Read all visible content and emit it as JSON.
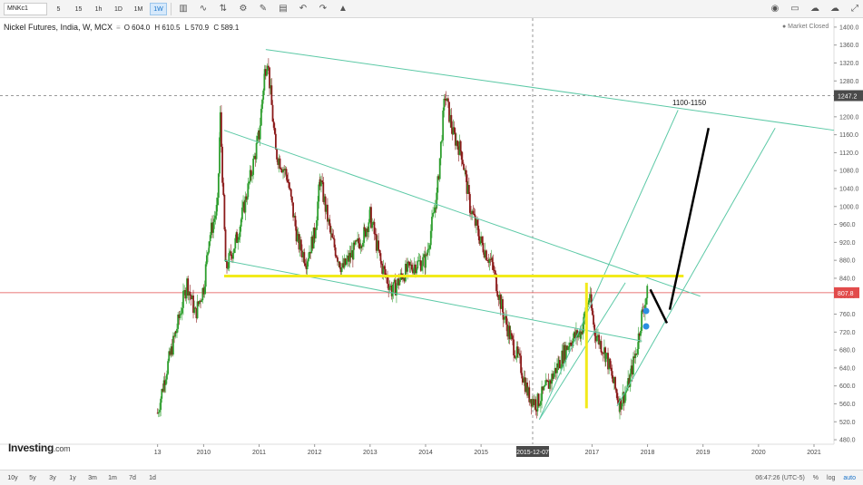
{
  "toolbar": {
    "symbol": "MNKc1",
    "intervals": [
      {
        "label": "5",
        "active": false
      },
      {
        "label": "15",
        "active": false
      },
      {
        "label": "1h",
        "active": false
      },
      {
        "label": "1D",
        "active": false
      },
      {
        "label": "1M",
        "active": false
      },
      {
        "label": "1W",
        "active": true
      }
    ],
    "tools": [
      "candle-type-icon",
      "indicator-icon",
      "compare-icon",
      "settings-icon",
      "drawing-icon",
      "template-icon",
      "undo-icon",
      "redo-icon",
      "alert-icon"
    ],
    "right_tools": [
      "camera-icon",
      "layout-icon",
      "cloud-icon",
      "cloud-save-icon",
      "fullscreen-icon"
    ]
  },
  "legend": {
    "title": "Nickel Futures, India, W, MCX",
    "open": "O 604.0",
    "high": "H 610.5",
    "low": "L 570.9",
    "close": "C 589.1"
  },
  "market_status": "● Market Closed",
  "annotation_target": "1100-1150",
  "logo_text": "Investing",
  "logo_suffix": ".com",
  "time_ranges": [
    "10y",
    "5y",
    "3y",
    "1y",
    "3m",
    "1m",
    "7d",
    "1d"
  ],
  "status_bar": {
    "clock": "06:47:26 (UTC-5)",
    "percent": "%",
    "log": "log",
    "auto": "auto"
  },
  "price_badges": {
    "crosshair": "1247.2",
    "last": "807.8"
  },
  "crosshair_date": "2015-12-07",
  "colors": {
    "up": "#2e9e2e",
    "down": "#8b1a1a",
    "trendline": "#5cc9a6",
    "horizontal": "#f2ea1a",
    "price_line": "#e24b4b",
    "target_arrow": "#000000"
  },
  "chart_data": {
    "type": "candlestick",
    "y_ticks": [
      1400,
      1360,
      1320,
      1280,
      1240,
      1200,
      1160,
      1120,
      1080,
      1040,
      1000,
      960,
      920,
      880,
      840,
      800,
      760,
      720,
      680,
      640,
      600,
      560,
      520,
      480
    ],
    "y_tick_labels": [
      "1400.0",
      "1360.0",
      "1320.0",
      "1280.0",
      "1240.0",
      "1200.0",
      "1160.0",
      "1120.0",
      "1080.0",
      "1040.0",
      "1000.0",
      "960.0",
      "920.0",
      "880.0",
      "840.0",
      "800.0",
      "760.0",
      "720.0",
      "680.0",
      "640.0",
      "600.0",
      "560.0",
      "520.0",
      "480.0"
    ],
    "x_ticks": [
      {
        "label": "13",
        "t": 2009.17
      },
      {
        "label": "2010",
        "t": 2010.0
      },
      {
        "label": "2011",
        "t": 2011.0
      },
      {
        "label": "2012",
        "t": 2012.0
      },
      {
        "label": "2013",
        "t": 2013.0
      },
      {
        "label": "2014",
        "t": 2014.0
      },
      {
        "label": "2015",
        "t": 2015.0
      },
      {
        "label": "2017",
        "t": 2017.0
      },
      {
        "label": "2018",
        "t": 2018.0
      },
      {
        "label": "2019",
        "t": 2019.0
      },
      {
        "label": "2020",
        "t": 2020.0
      },
      {
        "label": "2021",
        "t": 2021.0
      }
    ],
    "y_range": [
      470,
      1420
    ],
    "x_range": [
      2006.33,
      2021.36
    ],
    "crosshair": {
      "t": 2015.93,
      "price": 1247.2
    },
    "last_price": 807.8,
    "price_path": [
      [
        2009.17,
        540
      ],
      [
        2009.3,
        620
      ],
      [
        2009.5,
        720
      ],
      [
        2009.7,
        830
      ],
      [
        2009.85,
        760
      ],
      [
        2010.0,
        820
      ],
      [
        2010.1,
        930
      ],
      [
        2010.25,
        1000
      ],
      [
        2010.3,
        1200
      ],
      [
        2010.4,
        860
      ],
      [
        2010.6,
        930
      ],
      [
        2010.8,
        1040
      ],
      [
        2011.0,
        1160
      ],
      [
        2011.1,
        1300
      ],
      [
        2011.15,
        1330
      ],
      [
        2011.3,
        1120
      ],
      [
        2011.5,
        1070
      ],
      [
        2011.7,
        920
      ],
      [
        2011.85,
        880
      ],
      [
        2012.0,
        940
      ],
      [
        2012.1,
        1060
      ],
      [
        2012.3,
        930
      ],
      [
        2012.5,
        860
      ],
      [
        2012.7,
        900
      ],
      [
        2012.9,
        940
      ],
      [
        2013.0,
        980
      ],
      [
        2013.2,
        870
      ],
      [
        2013.4,
        810
      ],
      [
        2013.6,
        850
      ],
      [
        2013.8,
        870
      ],
      [
        2014.0,
        880
      ],
      [
        2014.2,
        1020
      ],
      [
        2014.35,
        1250
      ],
      [
        2014.5,
        1160
      ],
      [
        2014.65,
        1120
      ],
      [
        2014.8,
        1000
      ],
      [
        2015.0,
        920
      ],
      [
        2015.2,
        870
      ],
      [
        2015.4,
        760
      ],
      [
        2015.55,
        700
      ],
      [
        2015.7,
        650
      ],
      [
        2015.85,
        580
      ],
      [
        2016.0,
        560
      ],
      [
        2016.2,
        600
      ],
      [
        2016.4,
        650
      ],
      [
        2016.6,
        700
      ],
      [
        2016.8,
        720
      ],
      [
        2016.95,
        800
      ],
      [
        2017.05,
        720
      ],
      [
        2017.25,
        670
      ],
      [
        2017.4,
        600
      ],
      [
        2017.5,
        560
      ],
      [
        2017.65,
        600
      ],
      [
        2017.8,
        680
      ],
      [
        2017.9,
        760
      ],
      [
        2018.0,
        808
      ]
    ],
    "drawings": {
      "yellow_horizontal": {
        "t1": 2010.37,
        "t2": 2018.65,
        "price": 845
      },
      "yellow_vertical": {
        "t": 2016.9,
        "p1": 830,
        "p2": 550
      },
      "trend_upper": [
        [
          2011.12,
          1350
        ],
        [
          2021.36,
          1170
        ]
      ],
      "trend_channel_top": [
        [
          2010.37,
          1170
        ],
        [
          2018.95,
          800
        ]
      ],
      "trend_channel_bottom": [
        [
          2010.37,
          880
        ],
        [
          2017.9,
          700
        ]
      ],
      "fan_outer": [
        [
          2016.05,
          525
        ],
        [
          2018.55,
          1215
        ]
      ],
      "fan_inner": [
        [
          2017.45,
          555
        ],
        [
          2020.3,
          1175
        ]
      ],
      "fan_line_3": [
        [
          2016.05,
          525
        ],
        [
          2017.6,
          830
        ]
      ],
      "target_line_down": [
        [
          2018.05,
          815
        ],
        [
          2018.35,
          740
        ]
      ],
      "target_line_up": [
        [
          2018.4,
          770
        ],
        [
          2019.1,
          1175
        ]
      ]
    }
  }
}
